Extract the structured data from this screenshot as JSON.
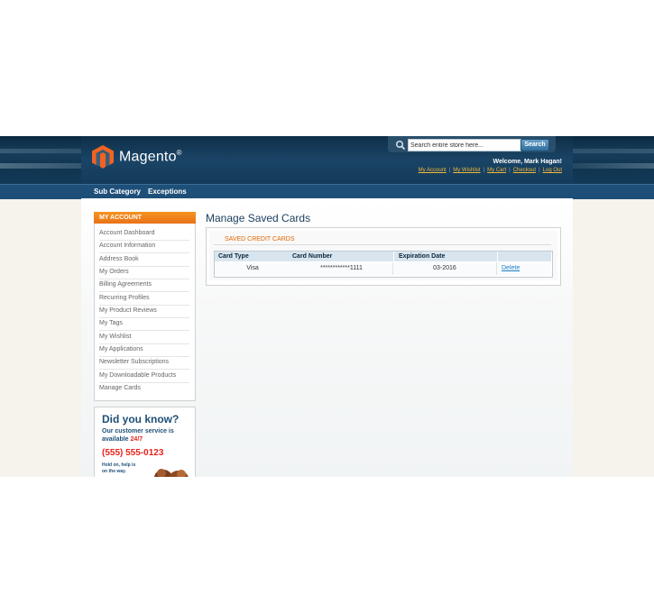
{
  "header": {
    "logo_text": "Magento",
    "logo_reg": "®",
    "search_placeholder": "Search entire store here...",
    "search_button": "Search",
    "welcome": "Welcome, Mark Hagan!",
    "links": [
      "My Account",
      "My Wishlist",
      "My Cart",
      "Checkout",
      "Log Out"
    ]
  },
  "nav": {
    "items": [
      "Sub Category",
      "Exceptions"
    ]
  },
  "sidebar": {
    "title": "MY ACCOUNT",
    "items": [
      "Account Dashboard",
      "Account Information",
      "Address Book",
      "My Orders",
      "Billing Agreements",
      "Recurring Profiles",
      "My Product Reviews",
      "My Tags",
      "My Wishlist",
      "My Applications",
      "Newsletter Subscriptions",
      "My Downloadable Products",
      "Manage Cards"
    ]
  },
  "promo": {
    "title": "Did you know?",
    "line1": "Our customer service is",
    "line2_prefix": "available ",
    "line2_highlight": "24/7",
    "phone": "(555) 555-0123",
    "hold1": "Hold on, help is",
    "hold2": "on the way."
  },
  "main": {
    "page_title": "Manage Saved Cards",
    "section_title": "SAVED CREDIT CARDS",
    "table": {
      "headers": [
        "Card Type",
        "Card Number",
        "Expiration Date",
        ""
      ],
      "rows": [
        {
          "type": "Visa",
          "number": "************1111",
          "expiration": "03-2016",
          "action": "Delete"
        }
      ]
    }
  },
  "colors": {
    "accent_orange": "#e8721a",
    "brand_navy": "#1d4f77",
    "link_blue": "#1e7ec8",
    "header_link": "#f3b83a"
  }
}
